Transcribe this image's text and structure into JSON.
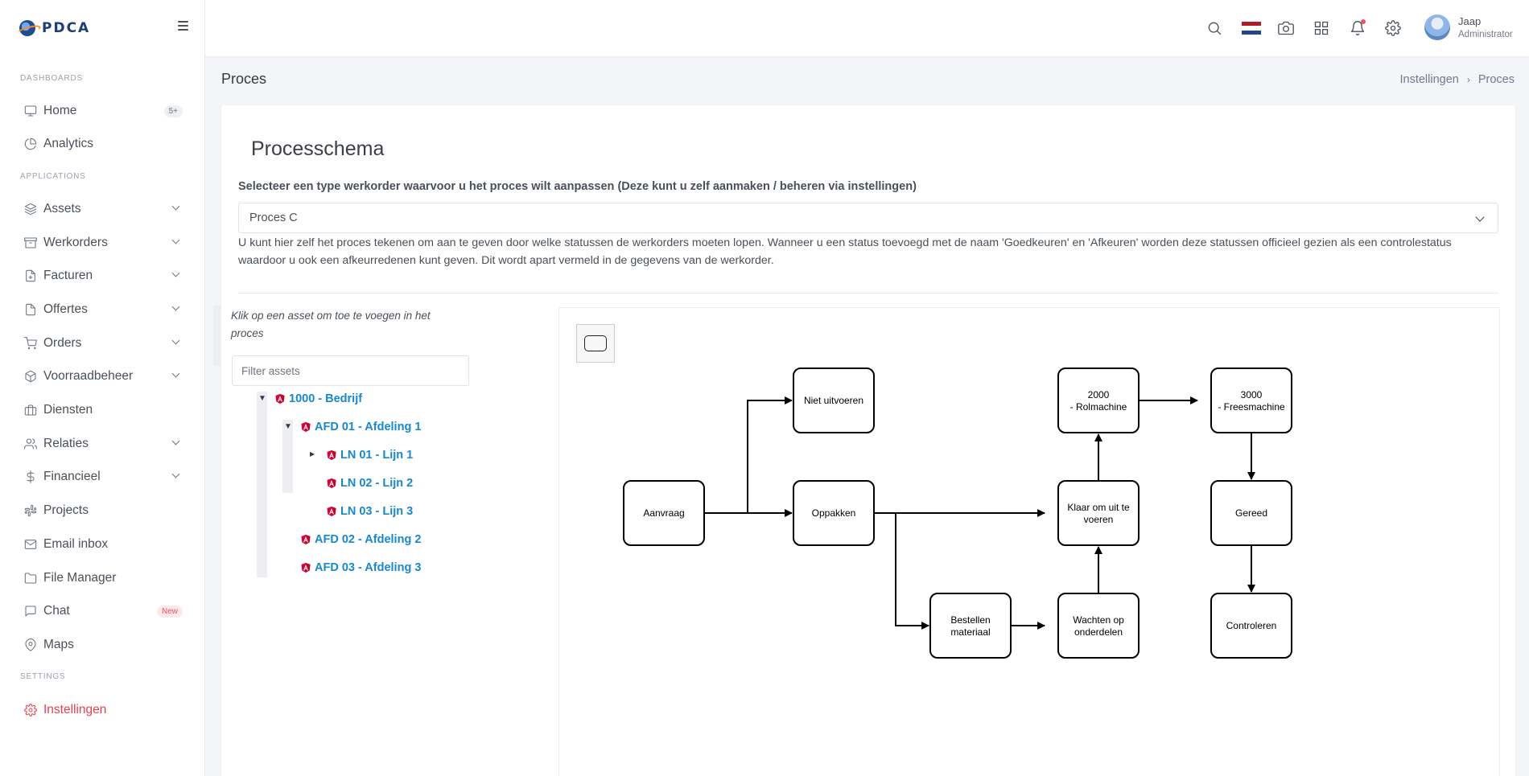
{
  "brand": {
    "name": "PDCA"
  },
  "sidebar": {
    "sections": {
      "dashboards": "DASHBOARDS",
      "applications": "APPLICATIONS",
      "settings": "SETTINGS"
    },
    "items": [
      {
        "label": "Home",
        "icon": "monitor-icon",
        "badge": "5+"
      },
      {
        "label": "Analytics",
        "icon": "pie-chart-icon"
      },
      {
        "label": "Assets",
        "icon": "layers-icon"
      },
      {
        "label": "Werkorders",
        "icon": "archive-icon"
      },
      {
        "label": "Facturen",
        "icon": "file-plus-icon"
      },
      {
        "label": "Offertes",
        "icon": "file-icon"
      },
      {
        "label": "Orders",
        "icon": "shopping-cart-icon"
      },
      {
        "label": "Voorraadbeheer",
        "icon": "box-icon"
      },
      {
        "label": "Diensten",
        "icon": "briefcase-icon"
      },
      {
        "label": "Relaties",
        "icon": "users-icon"
      },
      {
        "label": "Financieel",
        "icon": "dollar-icon"
      },
      {
        "label": "Projects",
        "icon": "slack-icon"
      },
      {
        "label": "Email inbox",
        "icon": "mail-icon"
      },
      {
        "label": "File Manager",
        "icon": "folder-icon"
      },
      {
        "label": "Chat",
        "icon": "message-square-icon",
        "badge": "New"
      },
      {
        "label": "Maps",
        "icon": "map-pin-icon"
      },
      {
        "label": "Instellingen",
        "icon": "settings-icon"
      }
    ]
  },
  "topbar": {
    "user": {
      "name": "Jaap",
      "role": "Administrator"
    },
    "flag_colors": [
      "#ae1c28",
      "#ffffff",
      "#21468b"
    ],
    "notification_color": "#f0505f"
  },
  "page": {
    "title": "Proces",
    "breadcrumb": [
      "Instellingen",
      "Proces"
    ]
  },
  "card": {
    "title": "Processchema",
    "select_label": "Selecteer een type werkorder waarvoor u het proces wilt aanpassen (Deze kunt u zelf aanmaken / beheren via instellingen)",
    "select_value": "Proces C",
    "help_text": "U kunt hier zelf het proces tekenen om aan te geven door welke statussen de werkorders moeten lopen. Wanneer u een status toevoegd met de naam 'Goedkeuren' en 'Afkeuren' worden deze statussen officieel gezien als een controlestatus waardoor u ook een afkeurredenen kunt geven. Dit wordt apart vermeld in de gegevens van de werkorder.",
    "asset_hint": "Klik op een asset om toe te voegen in het proces",
    "filter_placeholder": "Filter assets"
  },
  "tree": [
    {
      "label": "1000 - Bedrijf",
      "level": 0,
      "expanded": true
    },
    {
      "label": "AFD 01 - Afdeling 1",
      "level": 1,
      "expanded": true
    },
    {
      "label": "LN 01 - Lijn 1",
      "level": 2,
      "expanded": false,
      "has_children": true
    },
    {
      "label": "LN 02 - Lijn 2",
      "level": 2
    },
    {
      "label": "LN 03 - Lijn 3",
      "level": 2
    },
    {
      "label": "AFD 02 - Afdeling 2",
      "level": 1
    },
    {
      "label": "AFD 03 - Afdeling 3",
      "level": 1
    }
  ],
  "diagram": {
    "nodes": {
      "aanvraag": [
        "Aanvraag"
      ],
      "niet_uitvoeren": [
        "Niet uitvoeren"
      ],
      "oppakken": [
        "Oppakken"
      ],
      "bestellen": [
        "Bestellen",
        "materiaal"
      ],
      "wachten": [
        "Wachten op",
        "onderdelen"
      ],
      "klaar": [
        "Klaar om uit te",
        "voeren"
      ],
      "rolmachine": [
        "2000",
        "- Rolmachine"
      ],
      "freesmachine": [
        "3000",
        "- Freesmachine"
      ],
      "gereed": [
        "Gereed"
      ],
      "controleren": [
        "Controleren"
      ]
    }
  }
}
